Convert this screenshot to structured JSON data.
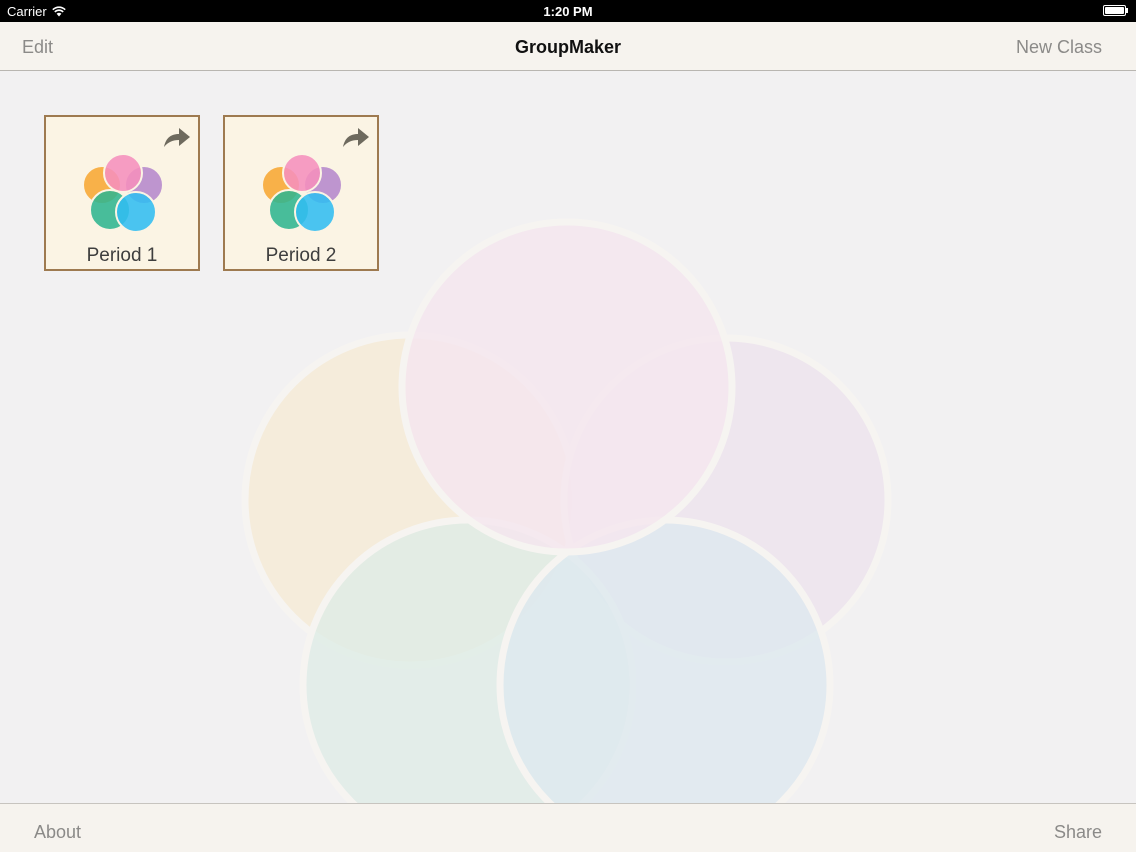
{
  "status_bar": {
    "carrier": "Carrier",
    "time": "1:20 PM",
    "wifi_icon": "wifi-icon",
    "battery_icon": "battery-icon"
  },
  "nav_bar": {
    "left_button": "Edit",
    "title": "GroupMaker",
    "right_button": "New Class"
  },
  "classes": [
    {
      "label": "Period 1",
      "icon": "flower-icon",
      "action_icon": "share-arrow-icon"
    },
    {
      "label": "Period 2",
      "icon": "flower-icon",
      "action_icon": "share-arrow-icon"
    }
  ],
  "toolbar": {
    "left_button": "About",
    "right_button": "Share"
  },
  "colors": {
    "tile_border": "#9e7a50",
    "tile_background": "#fbf4e4",
    "petal_orange": "#f7a733",
    "petal_pink": "#f58fbd",
    "petal_purple": "#b587cc",
    "petal_green": "#2fb58f",
    "petal_blue": "#31bdf1",
    "arrow": "#6e6a5e"
  }
}
